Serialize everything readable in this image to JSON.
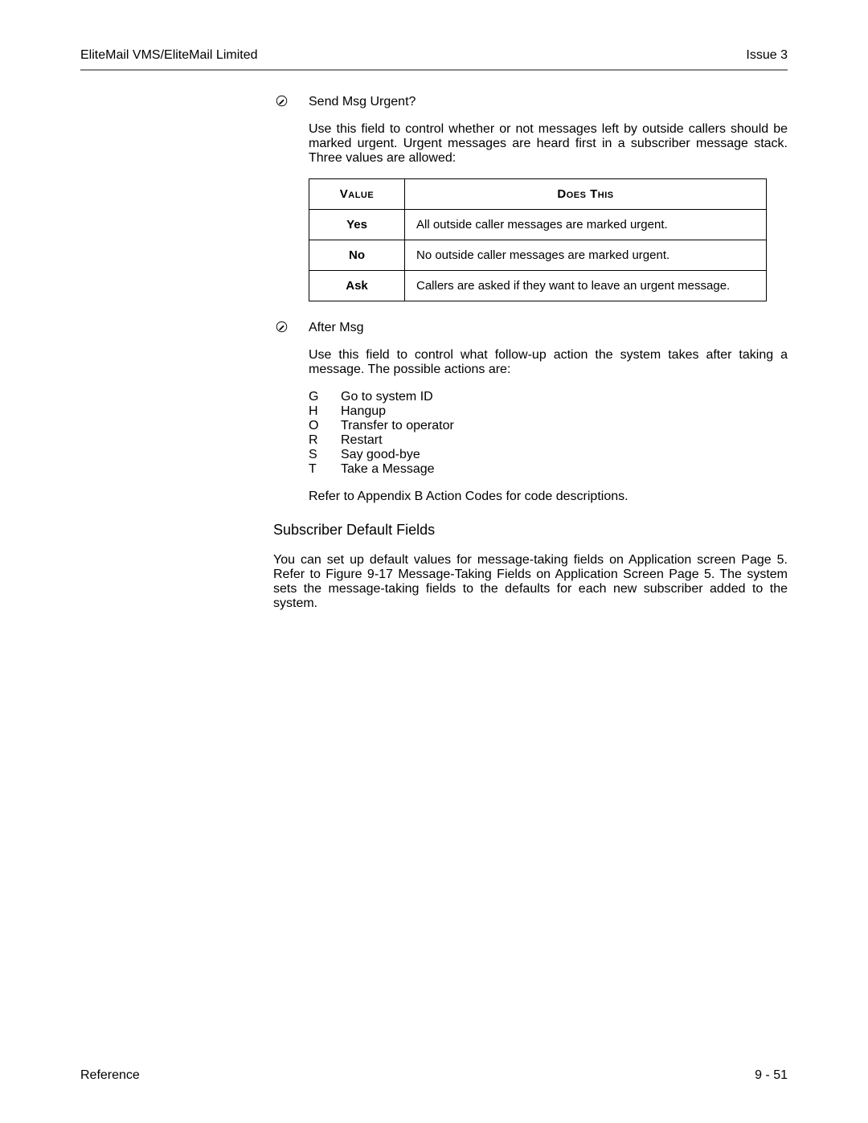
{
  "header": {
    "left": "EliteMail VMS/EliteMail Limited",
    "right": "Issue 3"
  },
  "section1": {
    "title": "Send Msg Urgent?",
    "para": "Use this field to control whether or not messages left by outside callers should be marked urgent. Urgent messages are heard first in a subscriber message stack. Three values are allowed:"
  },
  "table": {
    "head_value": "Value",
    "head_does": "Does This",
    "rows": [
      {
        "value": "Yes",
        "desc": "All outside caller messages are marked urgent."
      },
      {
        "value": "No",
        "desc": "No outside caller messages are marked urgent."
      },
      {
        "value": "Ask",
        "desc": "Callers are asked if they want to leave an urgent message."
      }
    ]
  },
  "section2": {
    "title": "After Msg",
    "para": "Use this field to control what follow-up action the system takes after taking a message. The possible actions are:",
    "codes": [
      {
        "c": "G",
        "d": "Go to system ID"
      },
      {
        "c": "H",
        "d": "Hangup"
      },
      {
        "c": "O",
        "d": "Transfer to operator"
      },
      {
        "c": "R",
        "d": "Restart"
      },
      {
        "c": "S",
        "d": "Say good-bye"
      },
      {
        "c": "T",
        "d": "Take a Message"
      }
    ],
    "ref": "Refer to Appendix B Action Codes for code descriptions."
  },
  "sub": {
    "heading": "Subscriber Default Fields",
    "para": "You can set up default values for message-taking fields on Application screen Page 5. Refer to Figure 9-17 Message-Taking Fields on Application Screen Page 5. The system sets the message-taking fields to the defaults for each new subscriber added to the system."
  },
  "footer": {
    "left": "Reference",
    "right": "9 - 51"
  }
}
